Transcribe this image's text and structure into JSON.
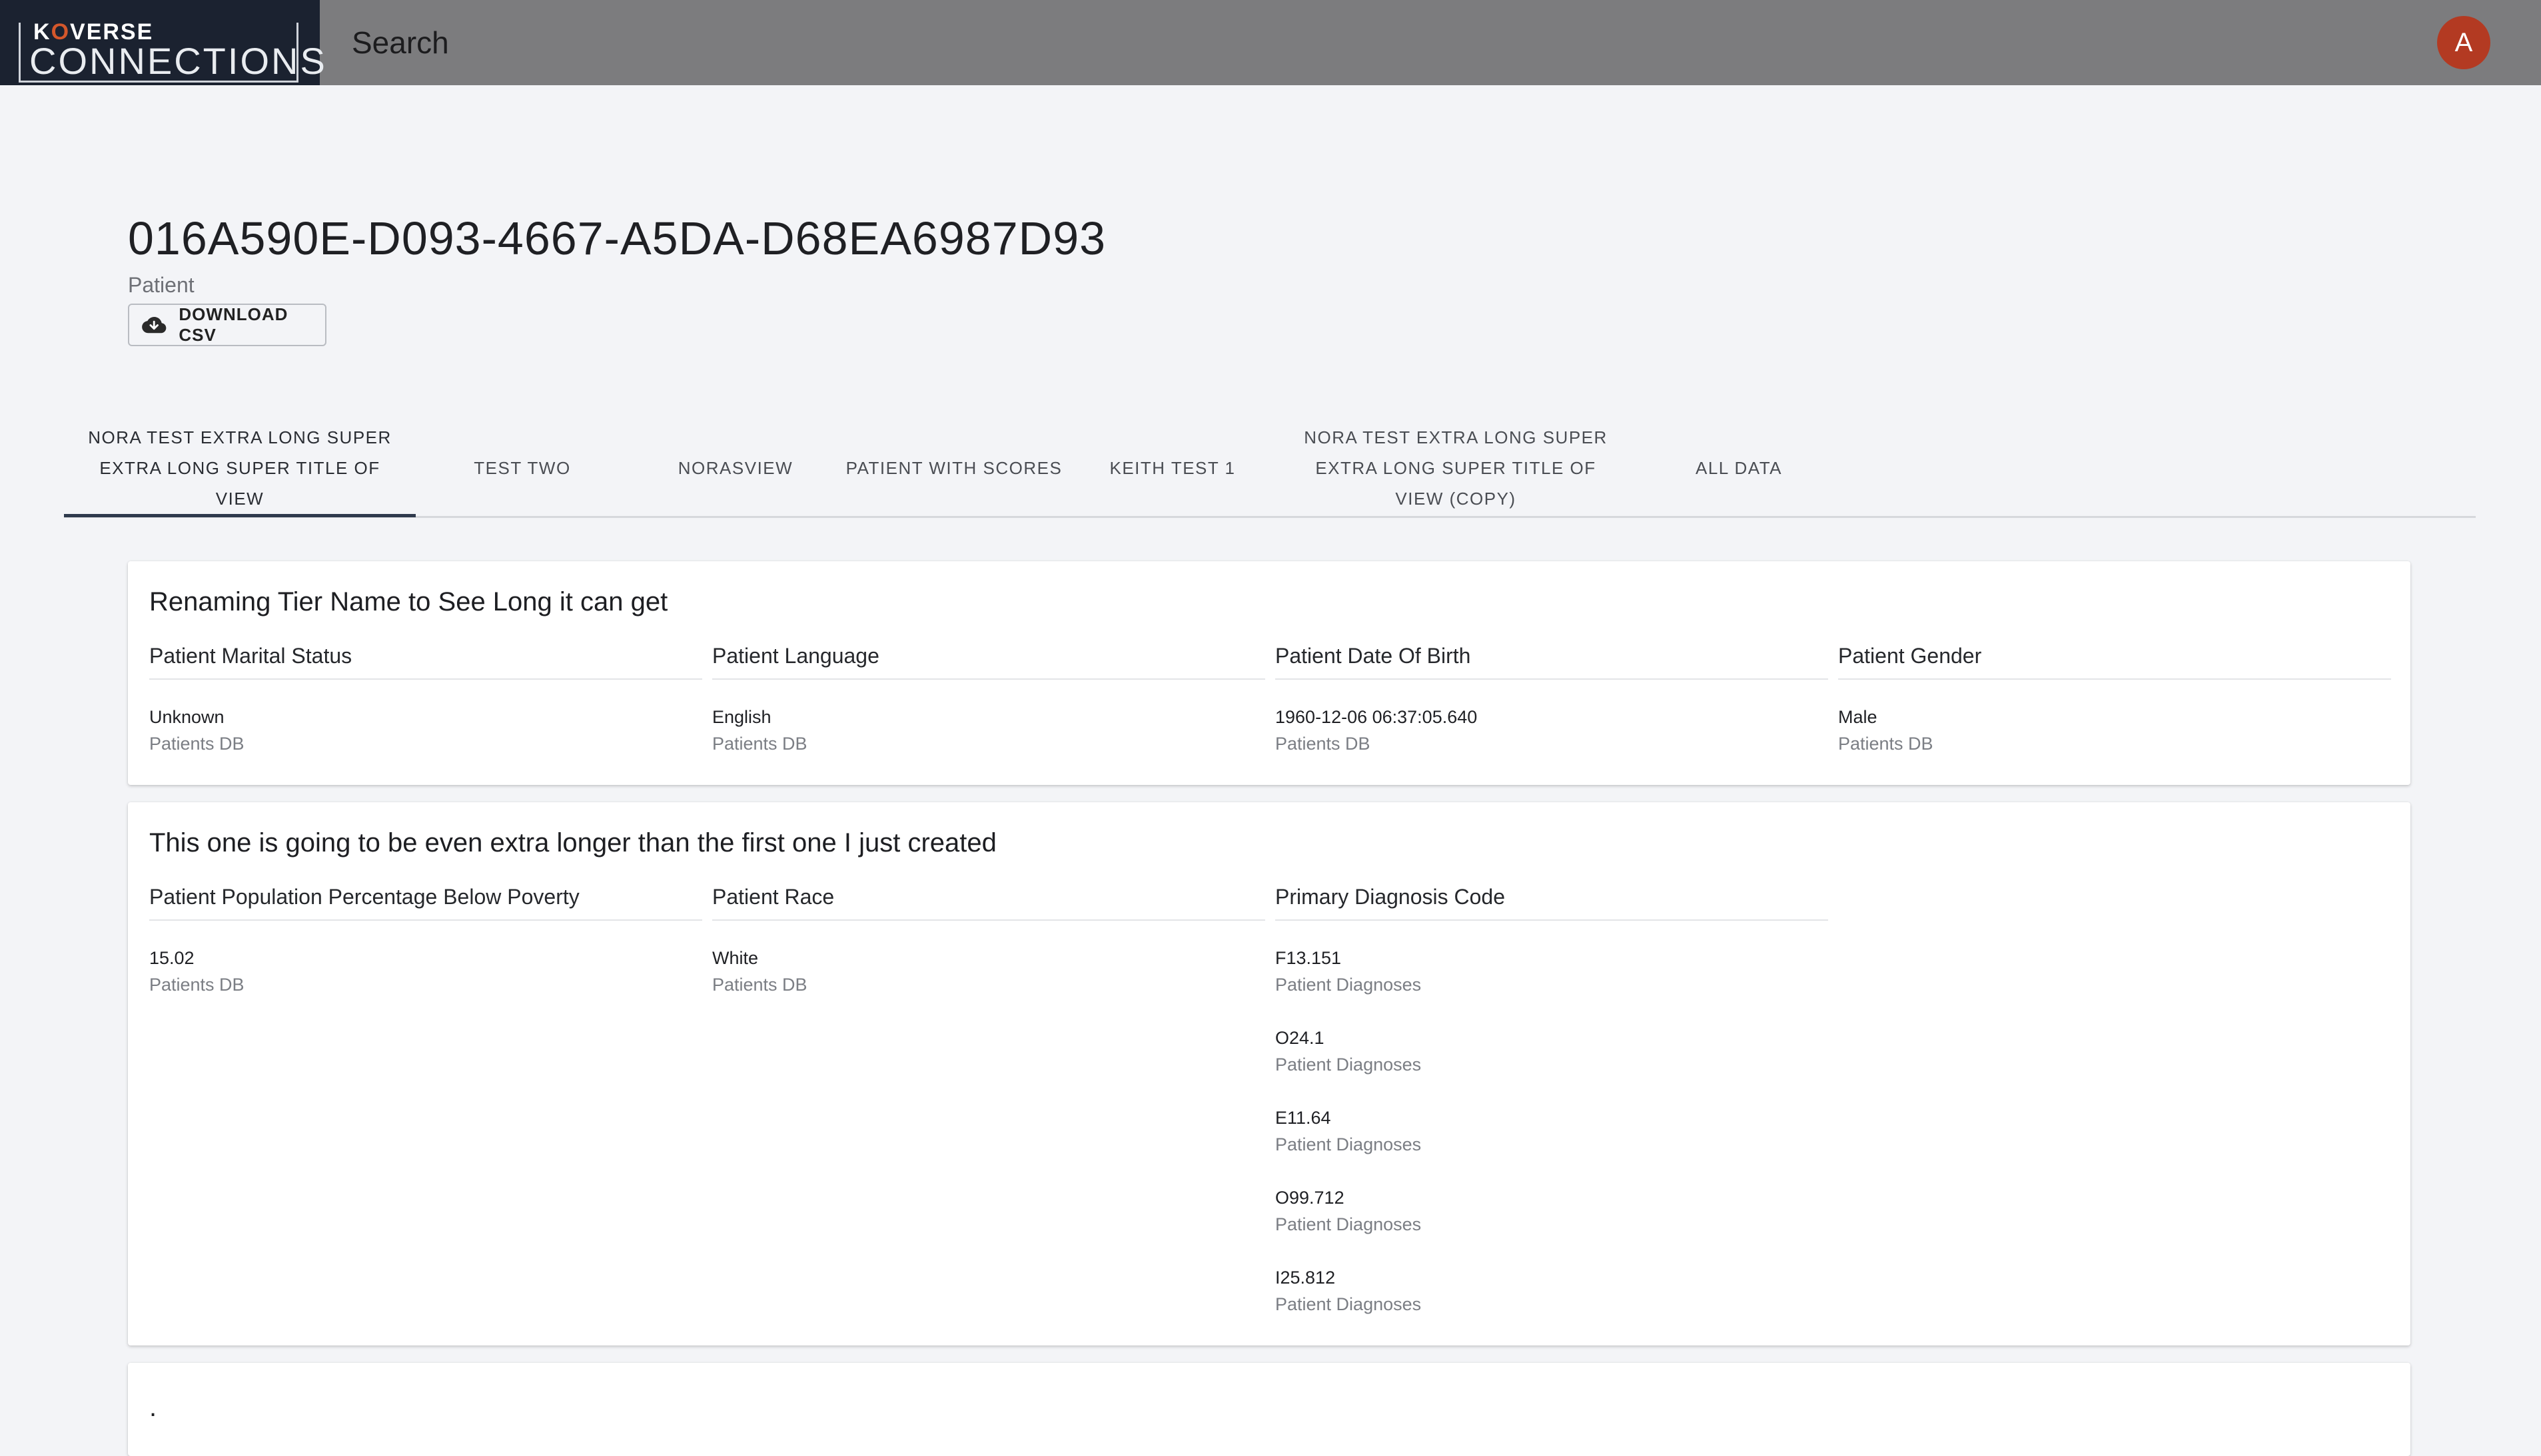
{
  "header": {
    "logo_top_prefix": "K",
    "logo_top_accent": "O",
    "logo_top_rest": "VERSE",
    "logo_main": "CONNECTIONS",
    "search_label": "Search",
    "avatar_initial": "A"
  },
  "page": {
    "title": "016A590E-D093-4667-A5DA-D68EA6987D93",
    "subtitle": "Patient",
    "download_label": "DOWNLOAD CSV"
  },
  "tabs": [
    {
      "label": "NORA TEST EXTRA LONG SUPER EXTRA LONG SUPER TITLE OF VIEW",
      "active": true
    },
    {
      "label": "TEST TWO"
    },
    {
      "label": "NORASVIEW"
    },
    {
      "label": "PATIENT WITH SCORES"
    },
    {
      "label": "KEITH TEST 1"
    },
    {
      "label": "NORA TEST EXTRA LONG SUPER EXTRA LONG SUPER TITLE OF VIEW (COPY)"
    },
    {
      "label": "ALL DATA"
    }
  ],
  "cards": [
    {
      "title": "Renaming Tier Name to See Long it can get",
      "columns": [
        {
          "header": "Patient Marital Status",
          "entries": [
            {
              "value": "Unknown",
              "source": "Patients DB"
            }
          ]
        },
        {
          "header": "Patient Language",
          "entries": [
            {
              "value": "English",
              "source": "Patients DB"
            }
          ]
        },
        {
          "header": "Patient Date Of Birth",
          "entries": [
            {
              "value": "1960-12-06 06:37:05.640",
              "source": "Patients DB"
            }
          ]
        },
        {
          "header": "Patient Gender",
          "entries": [
            {
              "value": "Male",
              "source": "Patients DB"
            }
          ]
        }
      ]
    },
    {
      "title": "This one is going to be even extra longer than the first one I just created",
      "columns": [
        {
          "header": "Patient Population Percentage Below Poverty",
          "entries": [
            {
              "value": "15.02",
              "source": "Patients DB"
            }
          ]
        },
        {
          "header": "Patient Race",
          "entries": [
            {
              "value": "White",
              "source": "Patients DB"
            }
          ]
        },
        {
          "header": "Primary Diagnosis Code",
          "entries": [
            {
              "value": "F13.151",
              "source": "Patient Diagnoses"
            },
            {
              "value": "O24.1",
              "source": "Patient Diagnoses"
            },
            {
              "value": "E11.64",
              "source": "Patient Diagnoses"
            },
            {
              "value": "O99.712",
              "source": "Patient Diagnoses"
            },
            {
              "value": "I25.812",
              "source": "Patient Diagnoses"
            }
          ]
        }
      ]
    },
    {
      "title": ".",
      "columns": []
    }
  ],
  "colors": {
    "topbar": "#7c7c7e",
    "logo_bg": "#1b2230",
    "logo_accent": "#d4572b",
    "avatar": "#b33a22",
    "tab_indicator": "#2f3a4d",
    "page_bg": "#f3f4f7"
  },
  "icons": {
    "download": "cloud-download-icon"
  }
}
